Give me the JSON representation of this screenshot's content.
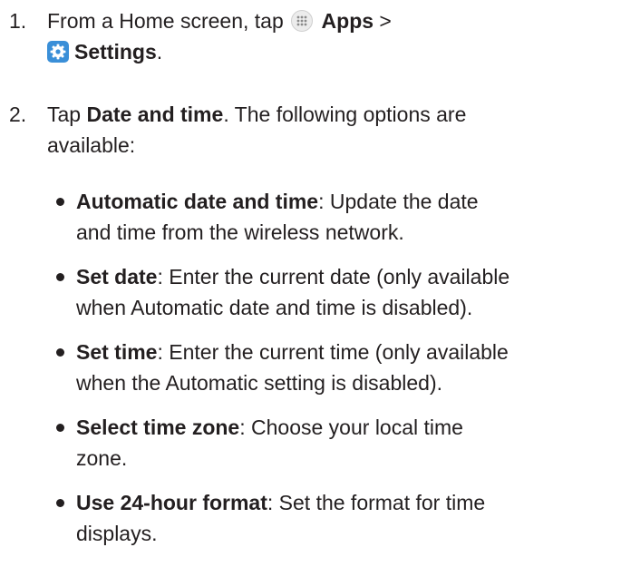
{
  "steps": [
    {
      "number": "1.",
      "lines": [
        {
          "pre": "From a Home screen, tap ",
          "apps_icon": "apps-icon",
          "bold": "Apps",
          "post": " >"
        },
        {
          "settings_icon": "gear-icon",
          "bold": "Settings",
          "post": "."
        }
      ]
    },
    {
      "number": "2.",
      "lines": [
        {
          "pre": "Tap ",
          "bold": "Date and time",
          "post": ". The following options are"
        },
        {
          "pre": "available:"
        }
      ]
    }
  ],
  "options": [
    {
      "term": "Automatic date and time",
      "line1": ": Update the date",
      "line2": "and time from the wireless network."
    },
    {
      "term": "Set date",
      "line1": ": Enter the current date (only available",
      "line2": "when Automatic date and time is disabled)."
    },
    {
      "term": "Set time",
      "line1": ": Enter the current time (only available",
      "line2": "when the Automatic setting is disabled)."
    },
    {
      "term": "Select time zone",
      "line1": ": Choose your local time",
      "line2": "zone."
    },
    {
      "term": "Use 24-hour format",
      "line1": ": Set the format for time",
      "line2": "displays."
    }
  ],
  "colors": {
    "text": "#231f20",
    "settings_icon_bg": "#3a8fd8",
    "apps_icon_bg": "#ececec"
  }
}
